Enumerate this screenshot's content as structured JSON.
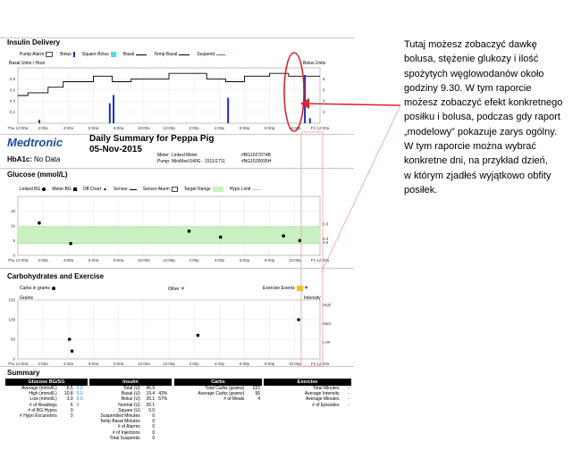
{
  "insulin": {
    "title": "Insulin Delivery",
    "legend": {
      "pump_alarm": "Pump Alarm",
      "bolus": "Bolus",
      "square_bolus": "Square Bolus",
      "basal": "Basal",
      "temp_basal": "Temp Basal",
      "suspend": "Suspend"
    },
    "basal_axis_label": "Basal Units / Hour",
    "bolus_axis_label": "Bolus Units",
    "left_ticks": [
      "0.8",
      "0.6",
      "0.4",
      "0.2"
    ],
    "right_ticks": [
      "8",
      "6",
      "4",
      "2"
    ],
    "x_ticks": [
      "Thu 12:00a",
      "2:00a",
      "4:00a",
      "6:00a",
      "8:00a",
      "10:00a",
      "12:00p",
      "2:00p",
      "4:00p",
      "6:00p",
      "8:00p",
      "10:00p",
      "Fri 12:00a"
    ]
  },
  "chart_data": [
    {
      "type": "line",
      "series_basal_hours": [
        0,
        0.8,
        0.8,
        2.4,
        2.4,
        3.6,
        3.6,
        6.0,
        6.0,
        7.5,
        7.5,
        9.0,
        9.0,
        12.0,
        12.0,
        15.0,
        15.0,
        16.5,
        16.5,
        18.0,
        18.0,
        20.0,
        20.0,
        21.5,
        21.5,
        24.0
      ],
      "series_basal_rate": [
        0.5,
        0.5,
        0.55,
        0.55,
        0.65,
        0.65,
        0.75,
        0.75,
        0.85,
        0.85,
        0.75,
        0.75,
        0.8,
        0.8,
        0.9,
        0.9,
        0.8,
        0.8,
        0.75,
        0.75,
        0.85,
        0.85,
        0.9,
        0.9,
        0.85,
        0.85
      ],
      "bolus_hours": [
        1.7,
        7.3,
        7.6,
        16.7,
        22.8,
        23.2
      ],
      "bolus_units": [
        0.6,
        3.6,
        5.1,
        4.6,
        8.7,
        0.9
      ],
      "ylim_left": [
        0,
        1
      ],
      "ylim_right": [
        0,
        10
      ],
      "xlim": [
        0,
        24
      ]
    },
    {
      "type": "scatter",
      "x_hours": [
        1.7,
        4.2,
        13.6,
        16.1,
        21.1,
        22.4
      ],
      "y_glucose": [
        11.0,
        4.0,
        8.2,
        6.2,
        6.6,
        5.0
      ],
      "target_range": [
        4.0,
        10.0
      ],
      "ylim": [
        0,
        20
      ],
      "xlim": [
        0,
        24
      ],
      "left_ticks": [
        "15",
        "10",
        "5",
        "0"
      ],
      "right_ticks": [
        "6.0",
        "5.0",
        "4.5"
      ]
    },
    {
      "type": "scatter",
      "x_hours": [
        4.1,
        4.3,
        14.3,
        22.3
      ],
      "y_carbs": [
        50,
        20,
        60,
        100
      ],
      "ylim": [
        0,
        150
      ],
      "xlim": [
        0,
        24
      ],
      "left_ticks": [
        "150",
        "100",
        "50",
        "0"
      ],
      "right_ticks": [
        "High",
        "Med",
        "Low"
      ]
    }
  ],
  "header": {
    "logo": "Medtronic",
    "report_title": "Daily Summary for Peppa Pig",
    "date": "05-Nov-2015",
    "meter_label": "Meter:",
    "meter_value": "Linked Meter",
    "meter_sn": "#BG1027074B",
    "pump_label": "Pump:",
    "pump_value": "MiniMed 640G - 1511/1711",
    "pump_sn": "#NG1520095H",
    "hba1c_label": "HbA1c:",
    "hba1c_value": "No Data"
  },
  "glucose": {
    "title": "Glucose (mmol/L)",
    "legend": {
      "linked_bg": "Linked BG",
      "meter_bg": "Meter BG",
      "off_chart": "Off Chart",
      "sensor": "Sensor",
      "sensor_alarm": "Sensor Alarm",
      "target_range": "Target Range",
      "hypo_limit": "Hypo Limit"
    },
    "x_ticks": [
      "Thu 12:00a",
      "2:00a",
      "4:00a",
      "6:00a",
      "8:00a",
      "10:00a",
      "12:00p",
      "2:00p",
      "4:00p",
      "6:00p",
      "8:00p",
      "10:00p",
      "Fri 12:00a"
    ]
  },
  "carbs": {
    "title": "Carbohydrates and Exercise",
    "legend": {
      "carbs_in_grams": "Carbs in grams",
      "other": "Other",
      "exercise_events": "Exercise Events"
    },
    "left_axis_label": "Grams",
    "right_axis_label": "Intensity",
    "x_ticks": [
      "Thu 12:00a",
      "2:00a",
      "4:00a",
      "6:00a",
      "8:00a",
      "10:00a",
      "12:00p",
      "2:00p",
      "4:00p",
      "6:00p",
      "8:00p",
      "10:00p",
      "Fri 12:00a"
    ]
  },
  "summary": {
    "title": "Summary",
    "glucose": {
      "header": "Glucose BG/SG",
      "rows": [
        {
          "label": "Average (mmol/L)",
          "v1": "6.5",
          "v2": "0.0"
        },
        {
          "label": "High (mmol/L)",
          "v1": "10.8",
          "v2": "0.0"
        },
        {
          "label": "Low (mmol/L)",
          "v1": "3.9",
          "v2": "0.0"
        },
        {
          "label": "# of Readings",
          "v1": "6",
          "v2": "0"
        },
        {
          "label": "# of BG Hypos",
          "v1": "0",
          "v2": ""
        },
        {
          "label": "# Hypo Excursions",
          "v1": "0",
          "v2": ""
        }
      ]
    },
    "insulin": {
      "header": "Insulin",
      "rows": [
        {
          "label": "Total (U)",
          "v1": "45.5",
          "v2": ""
        },
        {
          "label": "Basal (U)",
          "v1": "19.4",
          "v2": "43%"
        },
        {
          "label": "Bolus (U)",
          "v1": "26.1",
          "v2": "57%"
        },
        {
          "label": "Normal (U)",
          "v1": "26.1",
          "v2": ""
        },
        {
          "label": "Square (U)",
          "v1": "0.0",
          "v2": ""
        },
        {
          "label": "Suspended Minutes",
          "v1": "0",
          "v2": ""
        },
        {
          "label": "Temp Basal Minutes",
          "v1": "0",
          "v2": ""
        },
        {
          "label": "# of Alarms",
          "v1": "0",
          "v2": ""
        },
        {
          "label": "# of Injections",
          "v1": "0",
          "v2": ""
        },
        {
          "label": "Total Suspends",
          "v1": "0",
          "v2": ""
        }
      ]
    },
    "carbs": {
      "header": "Carbs",
      "rows": [
        {
          "label": "Total Carbs (grams)",
          "v1": "222"
        },
        {
          "label": "Average Carbs (grams)",
          "v1": "56"
        },
        {
          "label": "# of Meals",
          "v1": "4"
        }
      ]
    },
    "exercise": {
      "header": "Exercise",
      "rows": [
        {
          "label": "Total Minutes",
          "v1": "-"
        },
        {
          "label": "Average Intensity",
          "v1": "-"
        },
        {
          "label": "Average Minutes",
          "v1": "-"
        },
        {
          "label": "# of Episodes",
          "v1": "-"
        }
      ]
    }
  },
  "annotation": {
    "text": "Tutaj możesz zobaczyć dawkę\nbolusa, stężenie glukozy i ilość\nspożytych węglowodanów około\ngodziny 9.30. W tym raporcie\nmożesz zobaczyć efekt konkretnego\nposiłku i bolusa, podczas gdy raport\n„modelowy” pokazuje zarys ogólny.\nW tym raporcie można wybrać\nkonkretne dni, na przykład dzień,\nw którym zjadłeś wyjątkowo obfity\nposiłek.",
    "highlight_color": "#d9262c"
  },
  "colors": {
    "bolus": "#1b2fbf",
    "square_bolus": "#5ad8f0",
    "target_range": "#c8f0c0",
    "hypo_limit": "#a7e49c",
    "exercise": "#f2c21a",
    "logo_blue": "#1b4e9e"
  }
}
